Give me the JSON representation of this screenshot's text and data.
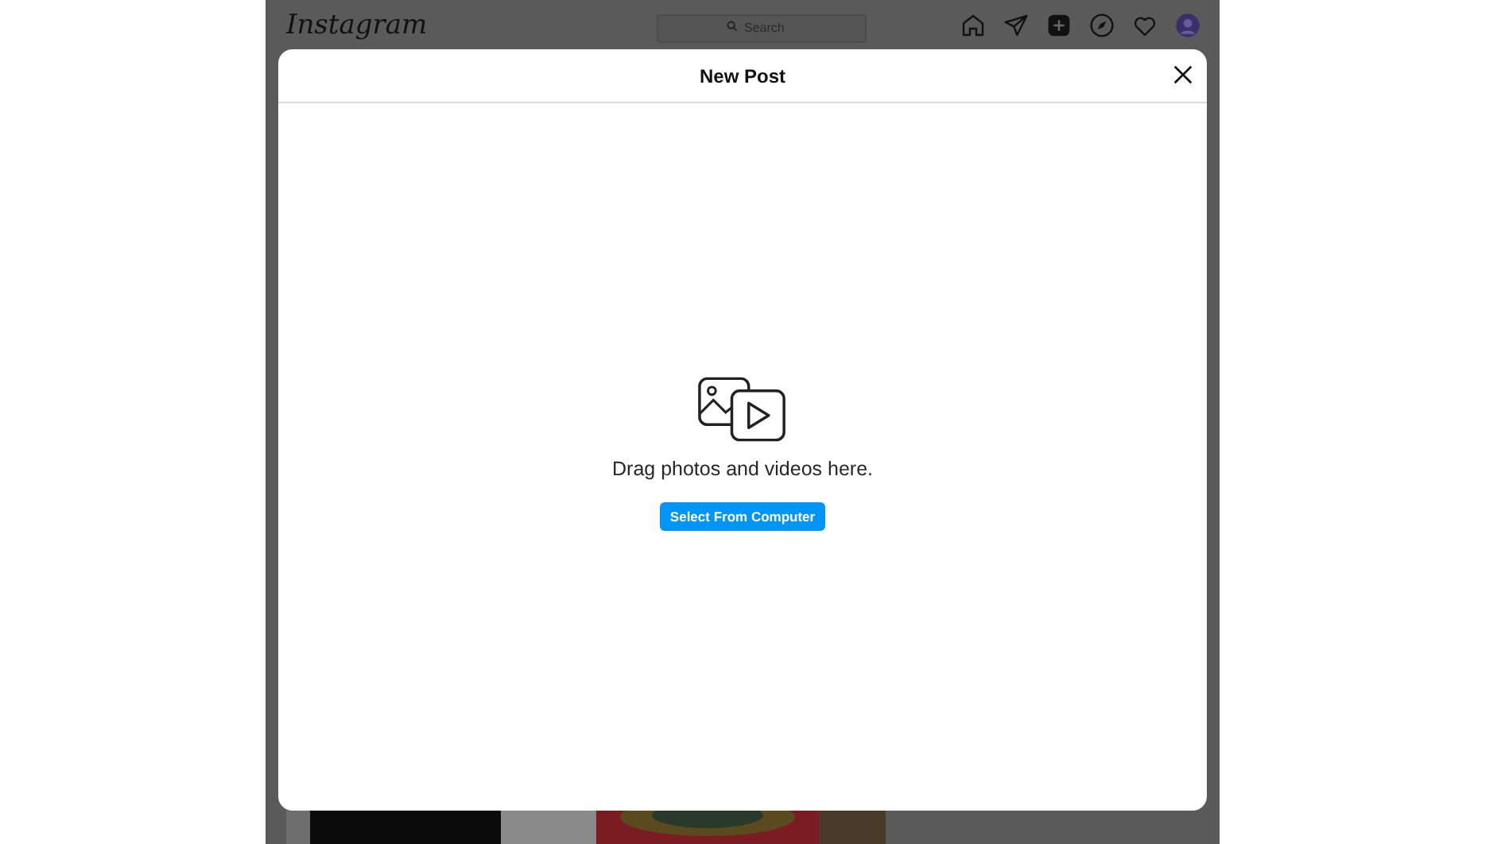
{
  "topbar": {
    "brand": "Instagram",
    "search": {
      "placeholder": "Search"
    }
  },
  "modal": {
    "title": "New Post",
    "message": "Drag photos and videos here.",
    "button": "Select From Computer"
  }
}
